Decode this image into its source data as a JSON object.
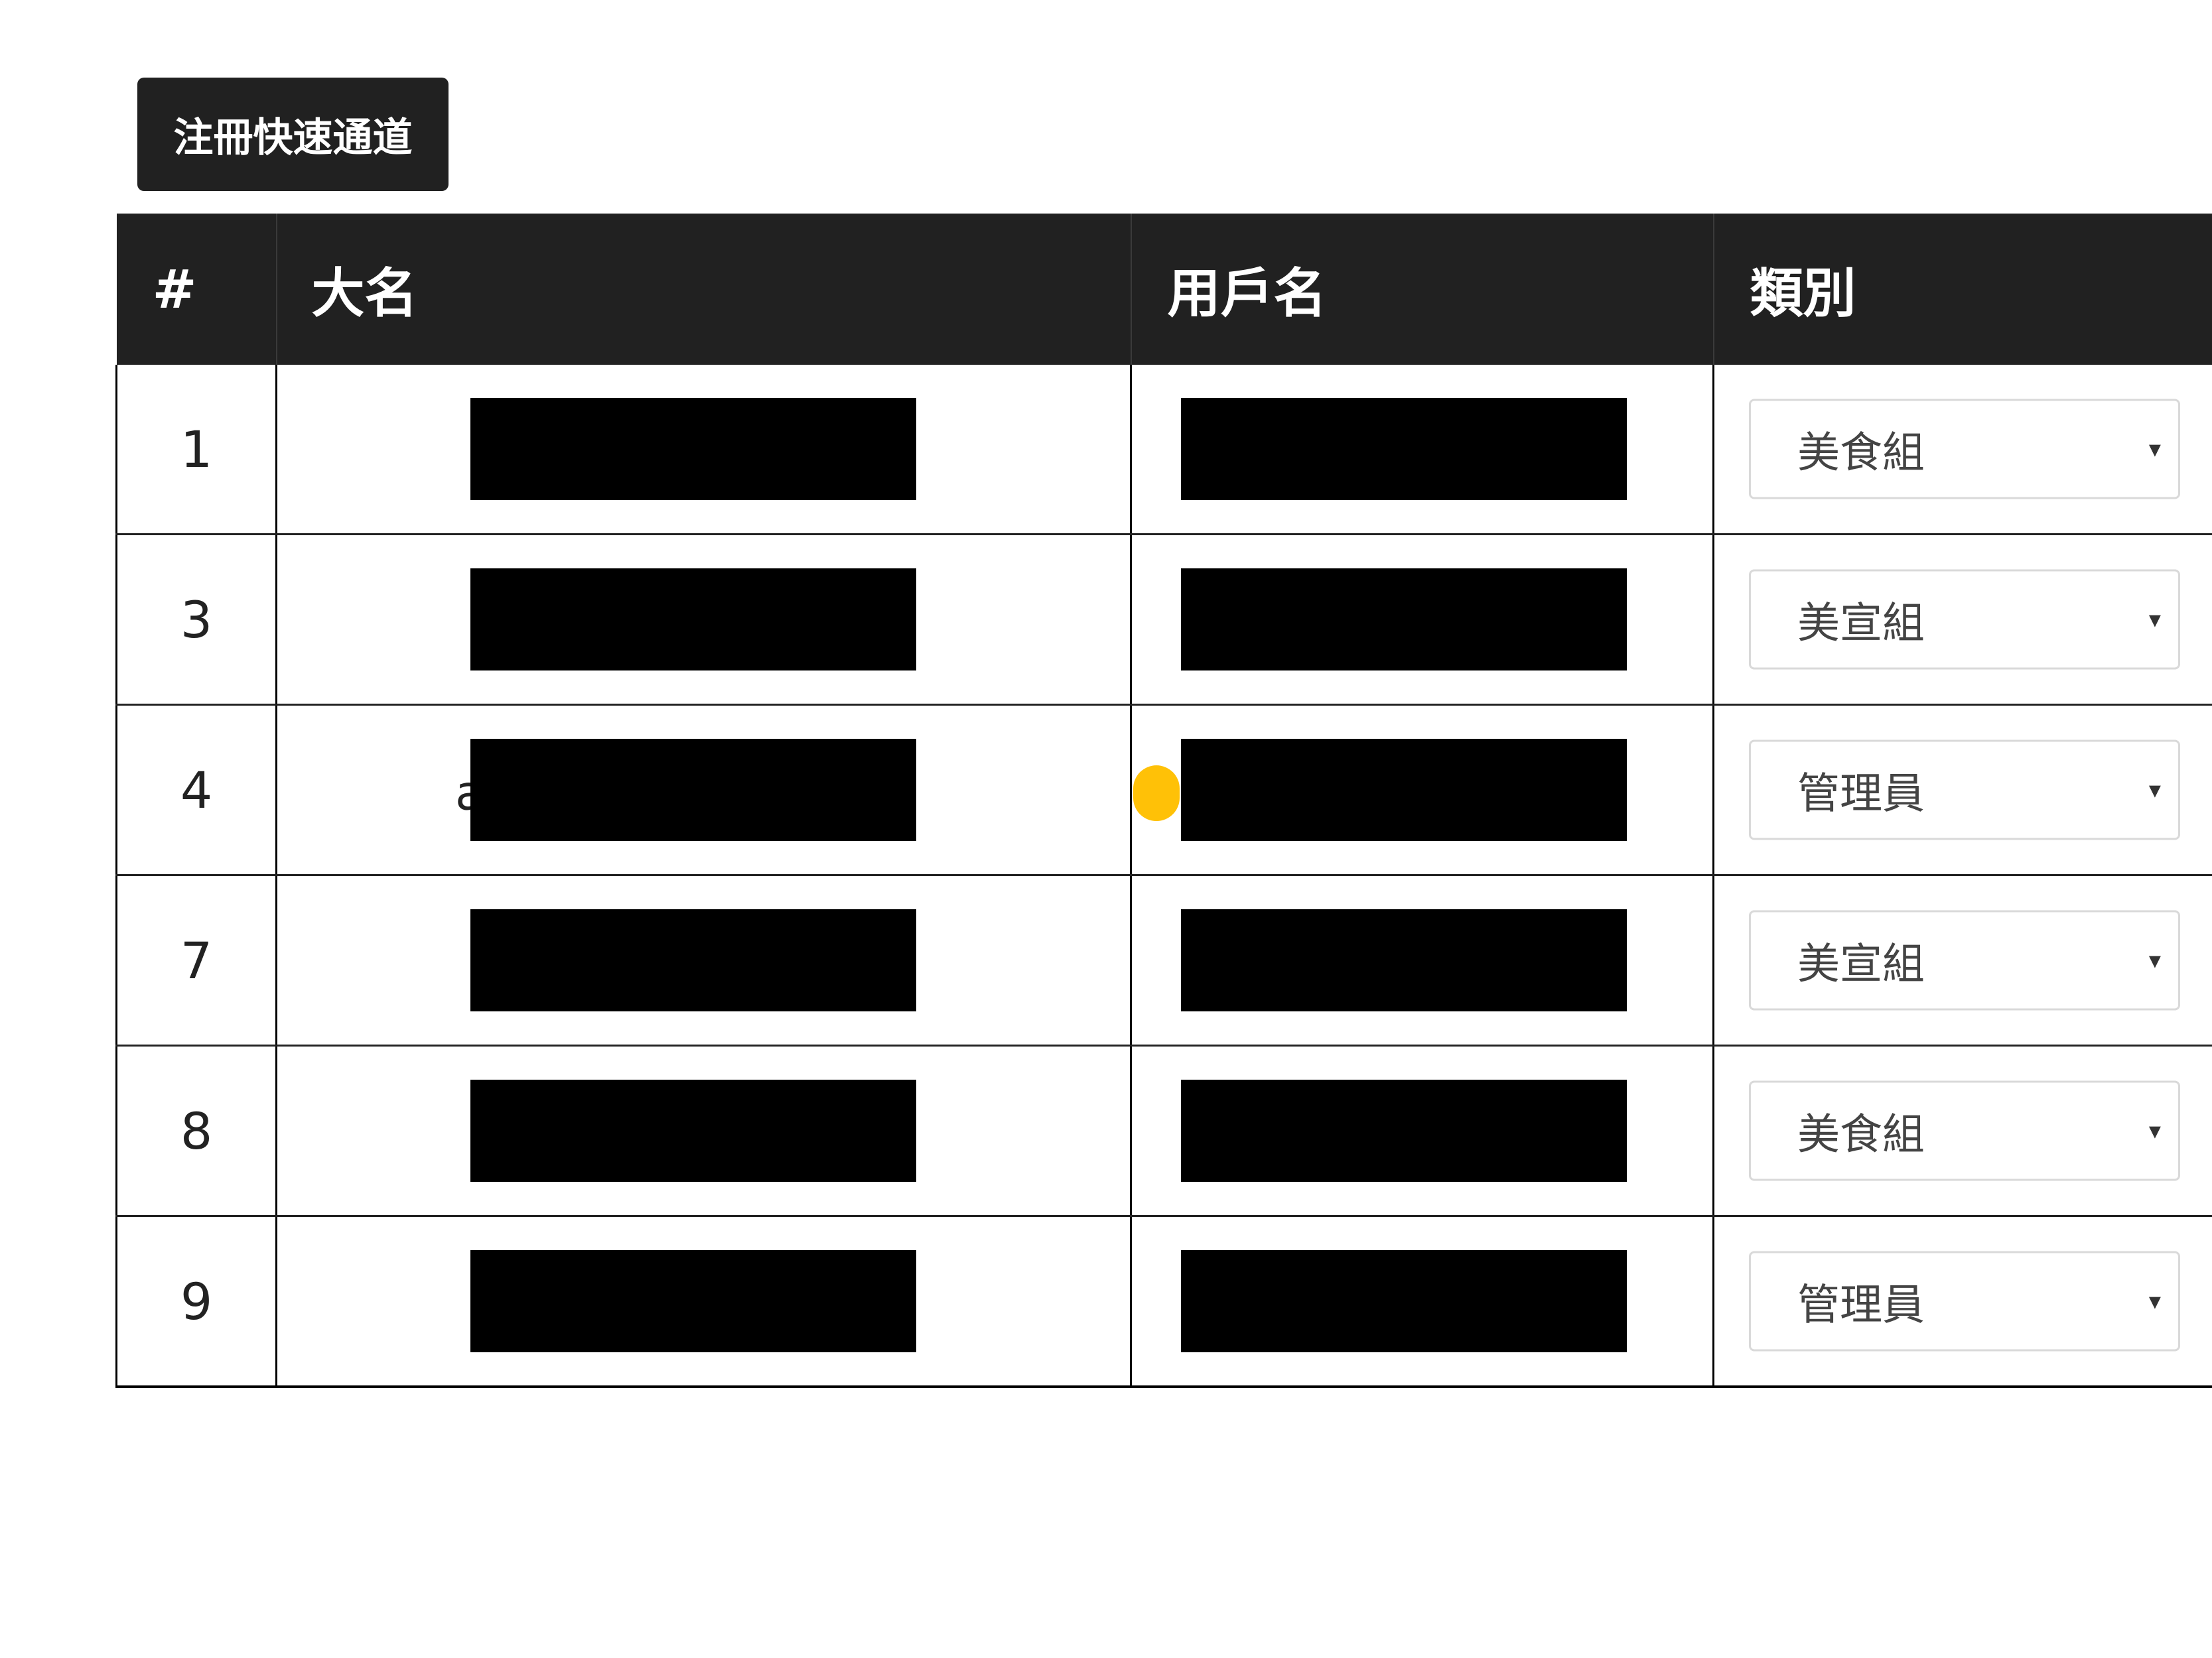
{
  "register_button": "注冊快速通道",
  "table": {
    "headers": {
      "num": "#",
      "name": "大名",
      "username": "用戶名",
      "role": "類別"
    },
    "rows": [
      {
        "num": "1",
        "role": "美食組"
      },
      {
        "num": "3",
        "role": "美宣組"
      },
      {
        "num": "4",
        "role": "管理員"
      },
      {
        "num": "7",
        "role": "美宣組"
      },
      {
        "num": "8",
        "role": "美食組"
      },
      {
        "num": "9",
        "role": "管理員"
      }
    ]
  },
  "row4_name_peek": "a",
  "dropdown_caret": "▾"
}
